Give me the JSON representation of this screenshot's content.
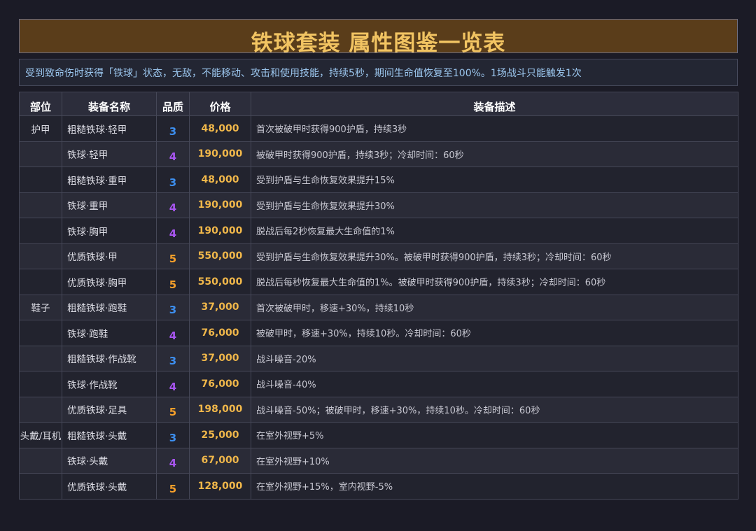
{
  "title": "铁球套装 属性图鉴一览表",
  "description": "受到致命伤时获得「铁球」状态，无敌，不能移动、攻击和使用技能，持续5秒，期间生命值恢复至100%。1场战斗只能触发1次",
  "headers": {
    "part": "部位",
    "name": "装备名称",
    "quality": "品质",
    "price": "价格",
    "desc": "装备描述"
  },
  "quality_colors": {
    "3": "#3d8ff0",
    "4": "#a855f0",
    "5": "#f59f2a"
  },
  "rows": [
    {
      "part": "护甲",
      "name": "粗糙铁球·轻甲",
      "quality": "3",
      "price": "48,000",
      "desc": "首次被破甲时获得900护盾，持续3秒"
    },
    {
      "part": "",
      "name": "铁球·轻甲",
      "quality": "4",
      "price": "190,000",
      "desc": "被破甲时获得900护盾，持续3秒；冷却时间：60秒"
    },
    {
      "part": "",
      "name": "粗糙铁球·重甲",
      "quality": "3",
      "price": "48,000",
      "desc": "受到护盾与生命恢复效果提升15%"
    },
    {
      "part": "",
      "name": "铁球·重甲",
      "quality": "4",
      "price": "190,000",
      "desc": "受到护盾与生命恢复效果提升30%"
    },
    {
      "part": "",
      "name": "铁球·胸甲",
      "quality": "4",
      "price": "190,000",
      "desc": "脱战后每2秒恢复最大生命值的1%"
    },
    {
      "part": "",
      "name": "优质铁球·甲",
      "quality": "5",
      "price": "550,000",
      "desc": "受到护盾与生命恢复效果提升30%。被破甲时获得900护盾，持续3秒；冷却时间：60秒"
    },
    {
      "part": "",
      "name": "优质铁球·胸甲",
      "quality": "5",
      "price": "550,000",
      "desc": "脱战后每秒恢复最大生命值的1%。被破甲时获得900护盾，持续3秒；冷却时间：60秒"
    },
    {
      "part": "鞋子",
      "name": "粗糙铁球·跑鞋",
      "quality": "3",
      "price": "37,000",
      "desc": "首次被破甲时，移速+30%，持续10秒"
    },
    {
      "part": "",
      "name": "铁球·跑鞋",
      "quality": "4",
      "price": "76,000",
      "desc": "被破甲时，移速+30%，持续10秒。冷却时间：60秒"
    },
    {
      "part": "",
      "name": "粗糙铁球·作战靴",
      "quality": "3",
      "price": "37,000",
      "desc": "战斗噪音-20%"
    },
    {
      "part": "",
      "name": "铁球·作战靴",
      "quality": "4",
      "price": "76,000",
      "desc": "战斗噪音-40%"
    },
    {
      "part": "",
      "name": "优质铁球·足具",
      "quality": "5",
      "price": "198,000",
      "desc": "战斗噪音-50%；被破甲时，移速+30%，持续10秒。冷却时间：60秒"
    },
    {
      "part": "头戴/耳机",
      "name": "粗糙铁球·头戴",
      "quality": "3",
      "price": "25,000",
      "desc": "在室外视野+5%"
    },
    {
      "part": "",
      "name": "铁球·头戴",
      "quality": "4",
      "price": "67,000",
      "desc": "在室外视野+10%"
    },
    {
      "part": "",
      "name": "优质铁球·头戴",
      "quality": "5",
      "price": "128,000",
      "desc": "在室外视野+15%，室内视野-5%"
    }
  ]
}
